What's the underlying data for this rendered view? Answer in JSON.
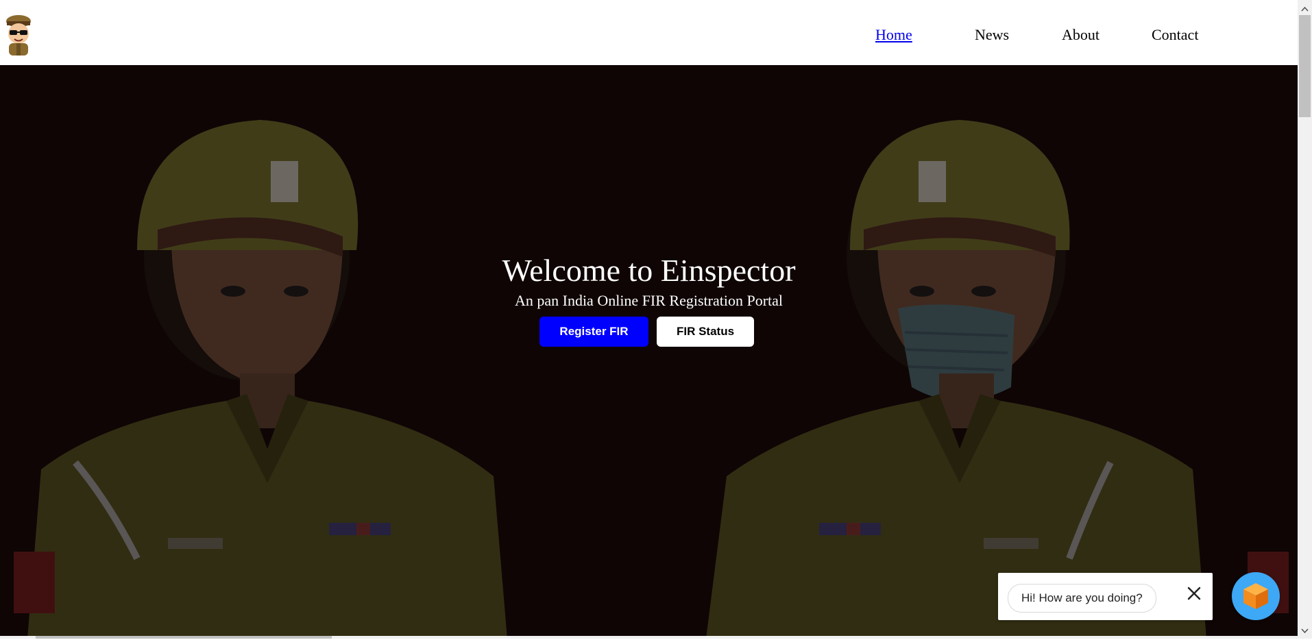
{
  "navbar": {
    "logo_icon": "inspector-mascot-logo",
    "links": [
      {
        "label": "Home",
        "active": true
      },
      {
        "label": "News",
        "active": false
      },
      {
        "label": "About",
        "active": false
      },
      {
        "label": "Contact",
        "active": false
      }
    ]
  },
  "hero": {
    "title": "Welcome to Einspector",
    "subtitle": "An pan India Online FIR Registration Portal",
    "primary_button": "Register FIR",
    "secondary_button": "FIR Status",
    "background_image": "two-police-officers-illustration"
  },
  "chat": {
    "message": "Hi! How are you doing?",
    "close_icon": "close-icon",
    "launcher_icon": "orange-cube-icon"
  },
  "colors": {
    "link_active": "#0000ee",
    "primary_button": "#0000ff",
    "hero_bg": "#0f0505",
    "chat_launcher": "#3da8f5"
  }
}
